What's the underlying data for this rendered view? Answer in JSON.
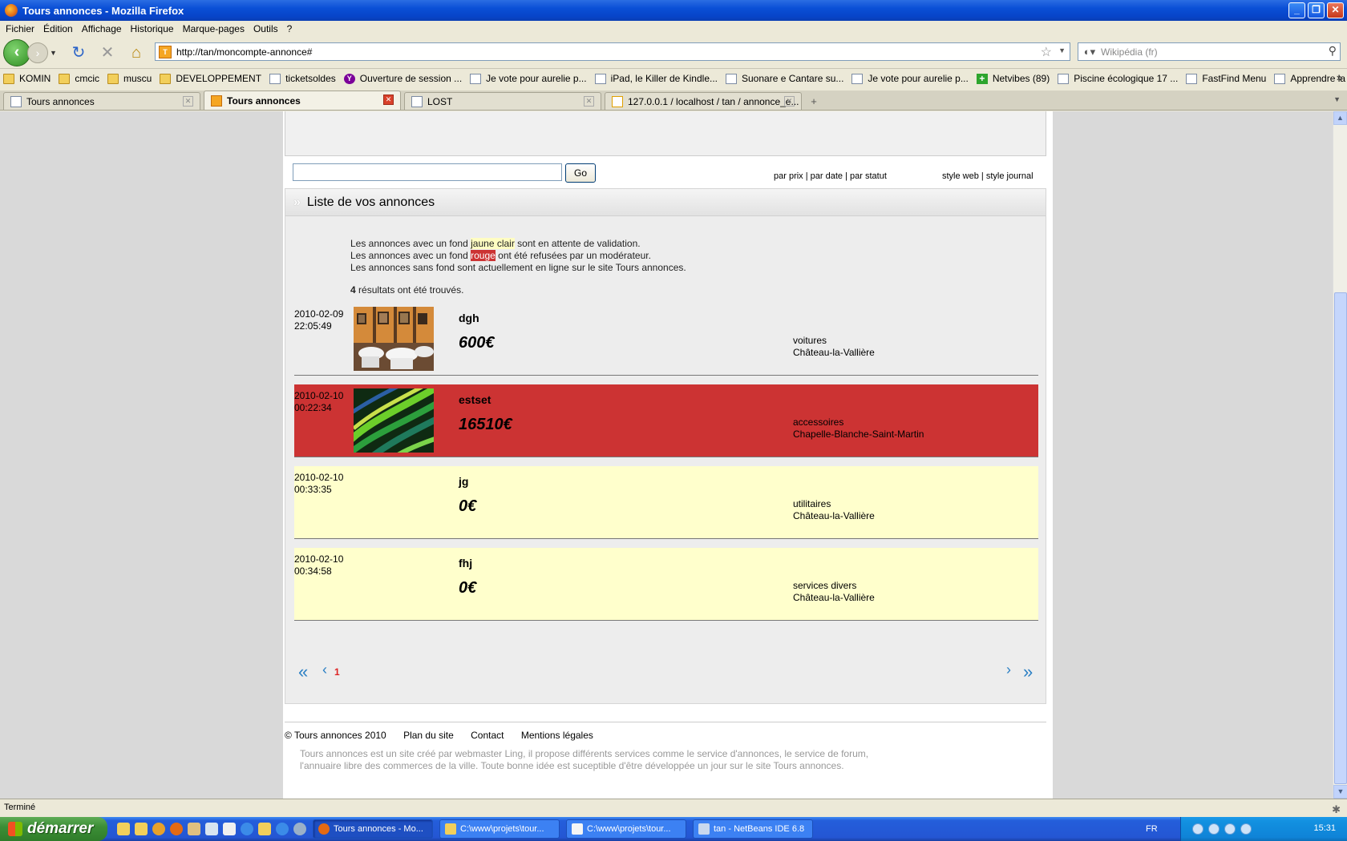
{
  "window": {
    "title": "Tours annonces - Mozilla Firefox",
    "min_label": "_",
    "max_label": "❐",
    "close_label": "✕"
  },
  "menu": [
    "Fichier",
    "Édition",
    "Affichage",
    "Historique",
    "Marque-pages",
    "Outils",
    "?"
  ],
  "nav": {
    "url": "http://tan/moncompte-annonce#",
    "search_placeholder": "Wikipédia (fr)"
  },
  "bookmarks": [
    {
      "label": "KOMIN",
      "icon": "folder-icon"
    },
    {
      "label": "cmcic",
      "icon": "folder-icon"
    },
    {
      "label": "muscu",
      "icon": "folder-icon"
    },
    {
      "label": "DEVELOPPEMENT",
      "icon": "folder-icon"
    },
    {
      "label": "ticketsoldes",
      "icon": "page-icon"
    },
    {
      "label": "Ouverture de session ...",
      "icon": "yahoo-icon"
    },
    {
      "label": "Je vote pour aurelie p...",
      "icon": "page-icon"
    },
    {
      "label": "iPad, le Killer de Kindle...",
      "icon": "page-icon"
    },
    {
      "label": "Suonare e Cantare su...",
      "icon": "page-icon"
    },
    {
      "label": "Je vote pour aurelie p...",
      "icon": "page-icon"
    },
    {
      "label": "Netvibes (89)",
      "icon": "netvibes-icon"
    },
    {
      "label": "Piscine écologique 17 ...",
      "icon": "page-icon"
    },
    {
      "label": "FastFind Menu",
      "icon": "page-icon"
    },
    {
      "label": "Apprendre la dactylog...",
      "icon": "page-icon"
    }
  ],
  "tabs": [
    {
      "label": "Tours annonces",
      "active": false
    },
    {
      "label": "Tours annonces",
      "active": true
    },
    {
      "label": "LOST",
      "active": false
    },
    {
      "label": "127.0.0.1 / localhost / tan / annonce_e...",
      "active": false
    }
  ],
  "page": {
    "go_label": "Go",
    "sort": {
      "prix": "par prix",
      "date": "par date",
      "statut": "par statut",
      "sep": " | "
    },
    "style": {
      "web": "style web",
      "journal": "style journal"
    },
    "section_title": "Liste de vos annonces",
    "info": {
      "line1_a": "Les annonces avec un fond ",
      "line1_hl": "jaune clair",
      "line1_b": " sont en attente de validation.",
      "line2_a": "Les annonces avec un fond ",
      "line2_hl": "rouge",
      "line2_b": " ont été refusées par un modérateur.",
      "line3": "Les annonces sans fond sont actuellement en ligne sur le site Tours annonces.",
      "count": "4",
      "count_text": " résultats ont été trouvés."
    },
    "listings": [
      {
        "date": "2010-02-09",
        "time": "22:05:49",
        "title": "dgh",
        "price": "600€",
        "category": "voitures",
        "city": "Château-la-Vallière",
        "status": "online"
      },
      {
        "date": "2010-02-10",
        "time": "00:22:34",
        "title": "estset",
        "price": "16510€",
        "category": "accessoires",
        "city": "Chapelle-Blanche-Saint-Martin",
        "status": "refused"
      },
      {
        "date": "2010-02-10",
        "time": "00:33:35",
        "title": "jg",
        "price": "0€",
        "category": "utilitaires",
        "city": "Château-la-Vallière",
        "status": "pending"
      },
      {
        "date": "2010-02-10",
        "time": "00:34:58",
        "title": "fhj",
        "price": "0€",
        "category": "services divers",
        "city": "Château-la-Vallière",
        "status": "pending"
      }
    ],
    "pager": {
      "first": "«",
      "prev": "‹",
      "current": "1",
      "next": "›",
      "last": "»"
    },
    "footer": {
      "copyright": "© Tours annonces 2010",
      "plan": "Plan du site",
      "contact": "Contact",
      "mentions": "Mentions légales",
      "desc": "Tours annonces est un site créé par webmaster Ling, il propose différents services comme le service d'annonces, le service de forum, l'annuaire libre des commerces de la ville. Toute bonne idée est suceptible d'être développée un jour sur le site Tours annonces."
    }
  },
  "status": "Terminé",
  "taskbar": {
    "start": "démarrer",
    "tasks": [
      {
        "label": "Tours annonces - Mo...",
        "active": true
      },
      {
        "label": "C:\\www\\projets\\tour...",
        "active": false
      },
      {
        "label": "C:\\www\\projets\\tour...",
        "active": false
      },
      {
        "label": "tan - NetBeans IDE 6.8",
        "active": false
      }
    ],
    "lang": "FR",
    "clock": "15:31"
  }
}
